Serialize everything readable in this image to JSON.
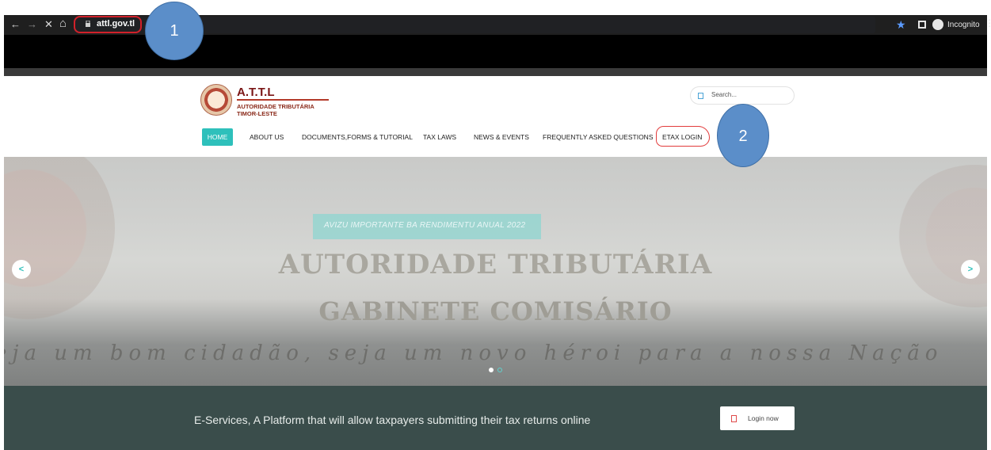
{
  "browser": {
    "back_glyph": "←",
    "forward_glyph": "→",
    "stop_glyph": "✕",
    "home_glyph": "⌂",
    "url": "attl.gov.tl",
    "star_glyph": "★",
    "incognito_label": "Incognito",
    "menu_glyph": "⋮"
  },
  "annotations": {
    "callout_1": "1",
    "callout_2": "2"
  },
  "site": {
    "logo_title": "A.T.T.L",
    "logo_sub1": "AUTORIDADE TRIBUTÁRIA",
    "logo_sub2": "TIMOR-LESTE",
    "search_placeholder": "Search...",
    "nav": [
      {
        "label": "HOME"
      },
      {
        "label": "ABOUT US"
      },
      {
        "label": "DOCUMENTS,FORMS & TUTORIAL"
      },
      {
        "label": "TAX LAWS"
      },
      {
        "label": "NEWS & EVENTS"
      },
      {
        "label": "FREQUENTLY ASKED QUESTIONS"
      },
      {
        "label": "ETAX LOGIN"
      }
    ]
  },
  "hero": {
    "badge": "AVIZU IMPORTANTE BA RENDIMENTU ANUAL 2022",
    "title_line1": "AUTORIDADE TRIBUTÁRIA",
    "title_line2": "GABINETE COMISÁRIO",
    "tagline": "eja um bom cidadão, seja um novo héroi para a nossa Nação",
    "prev_glyph": "<",
    "next_glyph": ">",
    "active_slide": 1,
    "slide_count": 2
  },
  "eservices": {
    "text": "E-Services, A Platform that will allow taxpayers submitting their tax returns online",
    "login_label": "Login now"
  },
  "colors": {
    "accent": "#2ec0bb",
    "band": "#3a4d4b",
    "brand": "#7a1515",
    "annotation": "#5b8ec9",
    "highlight": "#d2212a"
  }
}
